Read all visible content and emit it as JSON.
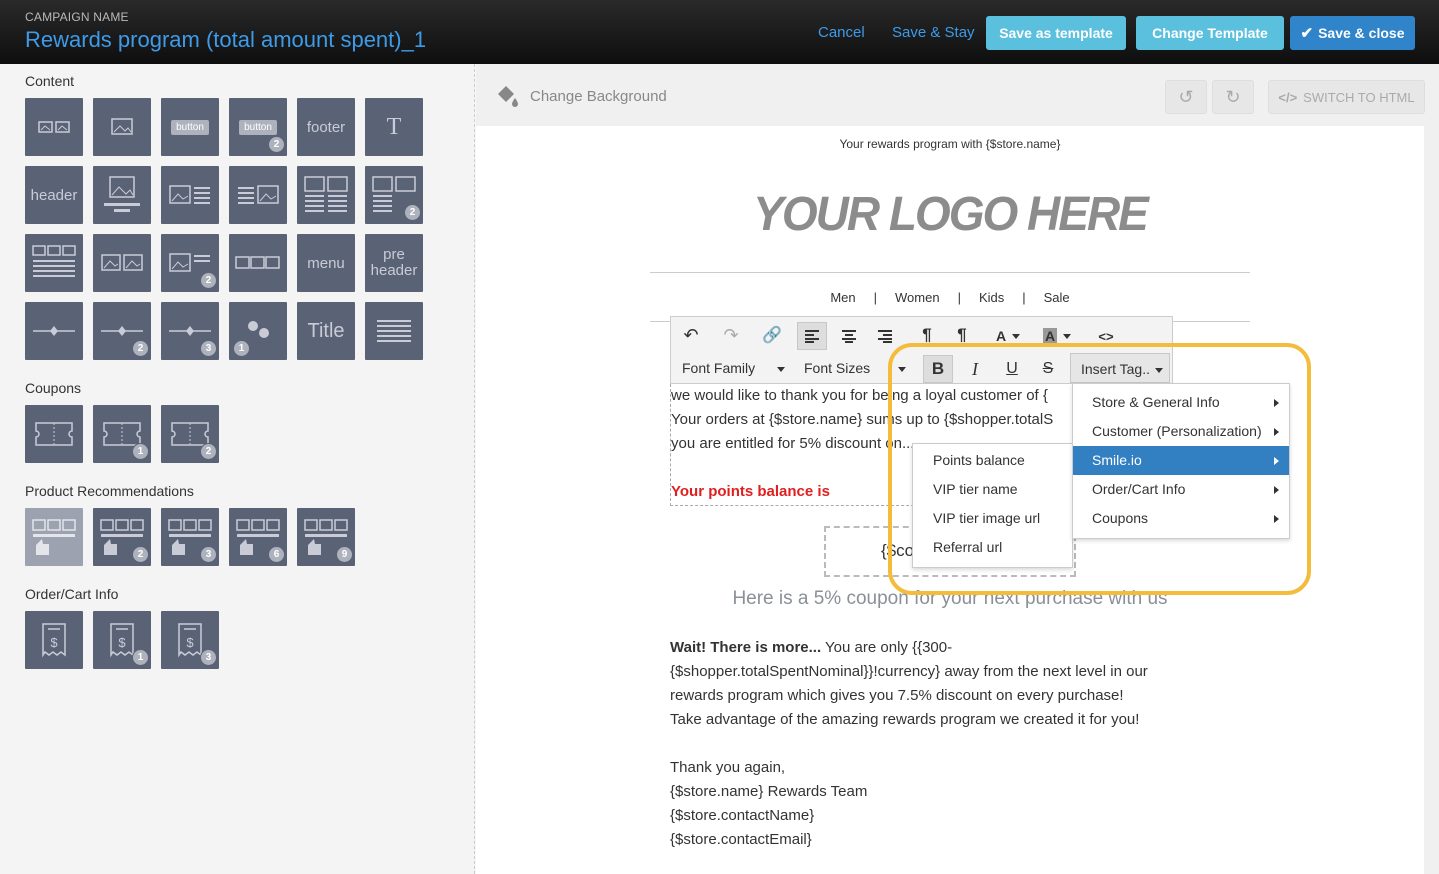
{
  "header": {
    "campaign_label": "CAMPAIGN NAME",
    "campaign_name": "Rewards program (total amount spent)_1",
    "cancel": "Cancel",
    "save_stay": "Save & Stay",
    "save_template": "Save as template",
    "change_template": "Change Template",
    "save_close": "Save & close"
  },
  "sidebar": {
    "content_title": "Content",
    "coupons_title": "Coupons",
    "products_title": "Product Recommendations",
    "order_title": "Order/Cart Info",
    "blocks": {
      "button": "button",
      "footer": "footer",
      "text": "T",
      "header": "header",
      "menu": "menu",
      "pre": "pre",
      "pre_header": "header",
      "title": "Title"
    },
    "badges": {
      "b1": "1",
      "b2": "2",
      "b3": "3",
      "b6": "6",
      "b9": "9"
    }
  },
  "canvas": {
    "change_background": "Change Background",
    "switch_html": "SWITCH TO HTML"
  },
  "email": {
    "preheader": "Your rewards program with {$store.name}",
    "logo": "YOUR LOGO HERE",
    "nav": [
      "Men",
      "Women",
      "Kids",
      "Sale"
    ],
    "line1": "we would like to thank you for being a loyal customer of {",
    "line2": "Your orders at {$store.name} sums up to {$shopper.totalS",
    "line3": "you are entitled for 5% discount on...",
    "points": "Your points balance is",
    "drop_text": "{$co",
    "coupon": "Here is a 5% coupon for your next purchase with us",
    "p2_bold": "Wait! There is more...",
    "p2_a": " You are only {{300-",
    "p2_b": "{$shopper.totalSpentNominal}}!currency} away from the next level in our",
    "p2_c": "rewards program which gives you 7.5% discount on every purchase!",
    "p2_d": "Take advantage of the amazing rewards program we created it for you!",
    "p3_a": "Thank you again,",
    "p3_b": "{$store.name} Rewards Team",
    "p3_c": "{$store.contactName}",
    "p3_d": "{$store.contactEmail}"
  },
  "toolbar": {
    "font_family": "Font Family",
    "font_sizes": "Font Sizes",
    "insert_tag": "Insert Tag..",
    "bold": "B",
    "italic": "I",
    "underline": "U",
    "strike": "S",
    "code": "<>"
  },
  "insert_menu": [
    "Store & General Info",
    "Customer (Personalization)",
    "Smile.io",
    "Order/Cart Info",
    "Coupons"
  ],
  "smile_menu": [
    "Points balance",
    "VIP tier name",
    "VIP tier image url",
    "Referral url"
  ],
  "colors": {
    "accent": "#3d9be9",
    "teal": "#5bc0de",
    "blue": "#2f84ca",
    "highlight": "#f3bd3b",
    "red": "#e02020"
  }
}
